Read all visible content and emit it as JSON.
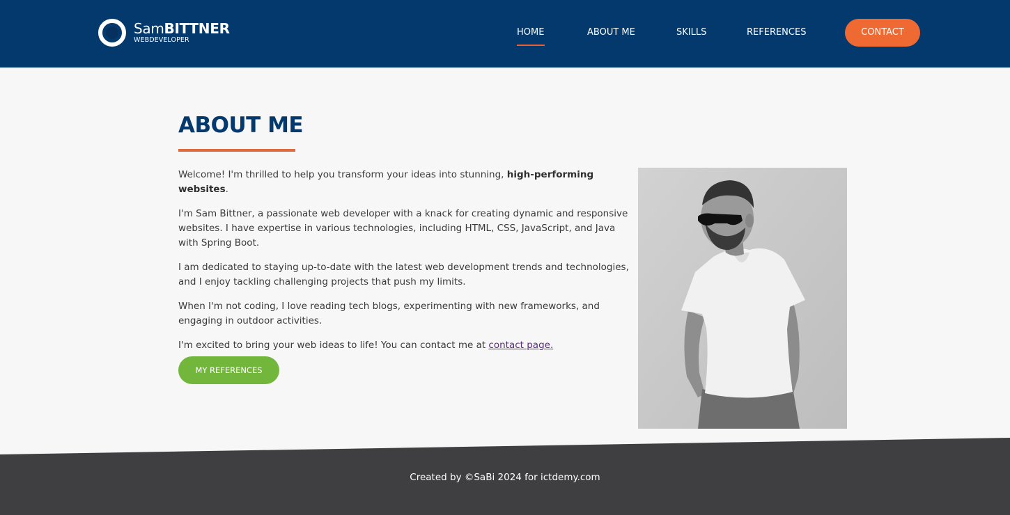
{
  "header": {
    "logo_first": "Sam",
    "logo_last": "BITTNER",
    "logo_sub": "WEBDEVELOPER",
    "nav": {
      "home": "HOME",
      "about": "ABOUT ME",
      "skills": "SKILLS",
      "references": "REFERENCES",
      "contact": "CONTACT"
    },
    "active_nav": "HOME"
  },
  "about": {
    "title": "ABOUT ME",
    "p1_before": "Welcome! I'm thrilled to help you transform your ideas into stunning, ",
    "p1_bold": "high-performing websites",
    "p1_after": ".",
    "p2": "I'm Sam Bittner, a passionate web developer with a knack for creating dynamic and responsive websites. I have expertise in various technologies, including HTML, CSS, JavaScript, and Java with Spring Boot.",
    "p3": "I am dedicated to staying up-to-date with the latest web development trends and technologies, and I enjoy tackling challenging projects that push my limits.",
    "p4": "When I'm not coding, I love reading tech blogs, experimenting with new frameworks, and engaging in outdoor activities.",
    "p5_before": "I'm excited to bring your web ideas to life! You can contact me at ",
    "p5_link": "contact page.",
    "button": "MY REFERENCES"
  },
  "footer": {
    "text": "Created by ©SaBi 2024 for ictdemy.com"
  },
  "colors": {
    "header_bg": "#03396c",
    "accent_orange": "#ef6a32",
    "button_green": "#72b63b",
    "footer_bg": "#3f3f41"
  }
}
